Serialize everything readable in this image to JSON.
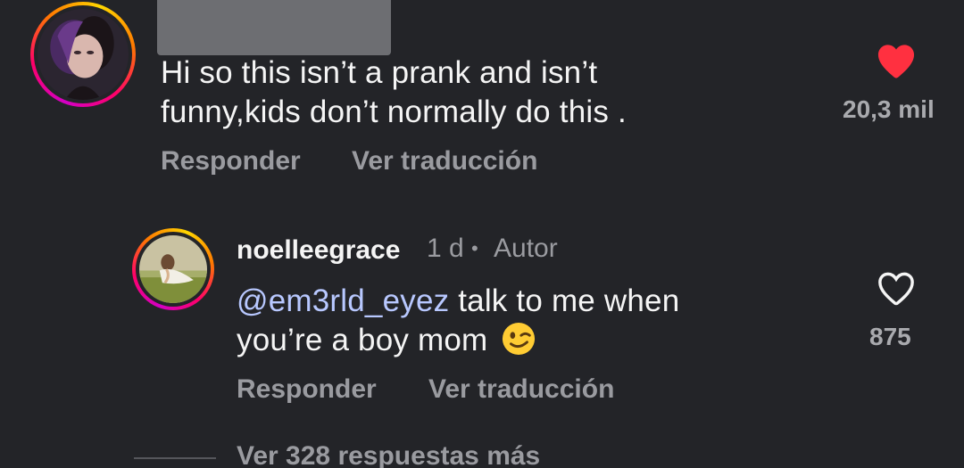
{
  "comment_main": {
    "text_line1": "Hi so this isn’t a prank and isn’t",
    "text_line2": "funny,kids don’t normally do this .",
    "like_count": "20,3 mil",
    "liked": true,
    "reply_label": "Responder",
    "translate_label": "Ver traducción"
  },
  "reply": {
    "username": "noelleegrace",
    "time": "1 d",
    "separator": "•",
    "author_badge": "Autor",
    "mention": "@em3rld_eyez",
    "text_line1_rest": " talk to me when",
    "text_line2": "you’re a boy mom",
    "emoji": "winking-face",
    "like_count": "875",
    "liked": false,
    "reply_label": "Responder",
    "translate_label": "Ver traducción"
  },
  "view_more_replies": "Ver 328 respuestas más",
  "colors": {
    "background": "#232428",
    "liked_heart": "#ff3040",
    "mention": "#b8c8ff",
    "secondary_text": "#9a9ba0"
  }
}
